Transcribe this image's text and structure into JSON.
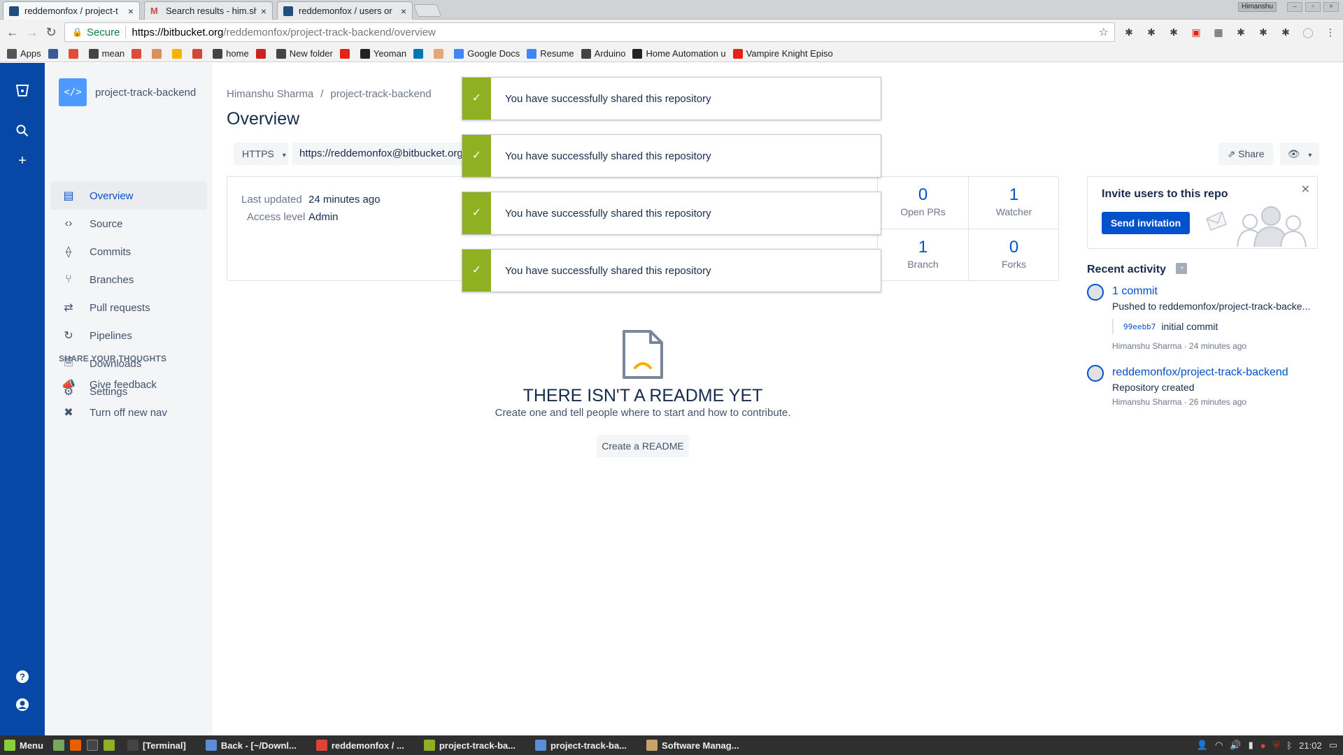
{
  "browser": {
    "tabs": [
      {
        "title": "reddemonfox / project-t",
        "active": true
      },
      {
        "title": "Search results - him.sha",
        "active": false
      },
      {
        "title": "reddemonfox / users or",
        "active": false
      }
    ],
    "window_user": "Himanshu",
    "address": {
      "secure_label": "Secure",
      "url_host": "https://bitbucket.org",
      "url_path": "/reddemonfox/project-track-backend/overview"
    },
    "bookmarks": [
      {
        "label": "Apps",
        "color": "#555555"
      },
      {
        "label": "",
        "color": "#3b5998"
      },
      {
        "label": "",
        "color": "#e04e39"
      },
      {
        "label": "mean",
        "color": "#444444"
      },
      {
        "label": "",
        "color": "#dd4b39"
      },
      {
        "label": "",
        "color": "#d9905a"
      },
      {
        "label": "",
        "color": "#f4b400"
      },
      {
        "label": "",
        "color": "#d44638"
      },
      {
        "label": "home",
        "color": "#444444"
      },
      {
        "label": "",
        "color": "#cc2222"
      },
      {
        "label": "New folder",
        "color": "#444444"
      },
      {
        "label": "",
        "color": "#e62117"
      },
      {
        "label": "Yeoman",
        "color": "#222222"
      },
      {
        "label": "",
        "color": "#0077b5"
      },
      {
        "label": "",
        "color": "#e3a87a"
      },
      {
        "label": "Google Docs",
        "color": "#4285f4"
      },
      {
        "label": "Resume",
        "color": "#4285f4"
      },
      {
        "label": "Arduino",
        "color": "#444444"
      },
      {
        "label": "Home Automation u",
        "color": "#222222"
      },
      {
        "label": "Vampire Knight Episo",
        "color": "#e62117"
      }
    ]
  },
  "sidebar": {
    "repo_name": "project-track-backend",
    "repo_avatar": "</>",
    "items": [
      {
        "label": "Overview",
        "icon": "overview-icon",
        "glyph": "▤",
        "active": true
      },
      {
        "label": "Source",
        "icon": "source-icon",
        "glyph": "‹›",
        "active": false
      },
      {
        "label": "Commits",
        "icon": "commits-icon",
        "glyph": "⟠",
        "active": false
      },
      {
        "label": "Branches",
        "icon": "branches-icon",
        "glyph": "⑂",
        "active": false
      },
      {
        "label": "Pull requests",
        "icon": "pull-requests-icon",
        "glyph": "⇄",
        "active": false
      },
      {
        "label": "Pipelines",
        "icon": "pipelines-icon",
        "glyph": "↻",
        "active": false
      },
      {
        "label": "Downloads",
        "icon": "downloads-icon",
        "glyph": "🗎",
        "active": false
      },
      {
        "label": "Settings",
        "icon": "settings-icon",
        "glyph": "⚙",
        "active": false
      }
    ],
    "section_heading": "SHARE YOUR THOUGHTS",
    "feedback_items": [
      {
        "label": "Give feedback",
        "icon": "megaphone-icon",
        "glyph": "📣"
      },
      {
        "label": "Turn off new nav",
        "icon": "close-circle-icon",
        "glyph": "✖"
      }
    ]
  },
  "main": {
    "breadcrumb": {
      "owner": "Himanshu Sharma",
      "separator": "/",
      "repo": "project-track-backend"
    },
    "title": "Overview",
    "clone": {
      "protocol": "HTTPS",
      "url": "https://reddemonfox@bitbucket.org"
    },
    "share_label": "Share",
    "info": {
      "last_updated_label": "Last updated",
      "last_updated_value": "24 minutes ago",
      "access_label": "Access level",
      "access_value": "Admin"
    },
    "stats": [
      {
        "num": "0",
        "label": "Open PRs"
      },
      {
        "num": "1",
        "label": "Watcher"
      },
      {
        "num": "1",
        "label": "Branch"
      },
      {
        "num": "0",
        "label": "Forks"
      }
    ],
    "toasts": [
      "You have successfully shared this repository",
      "You have successfully shared this repository",
      "You have successfully shared this repository",
      "You have successfully shared this repository"
    ],
    "readme": {
      "title": "THERE ISN'T A README YET",
      "subtitle": "Create one and tell people where to start and how to contribute.",
      "button": "Create a README"
    }
  },
  "right": {
    "invite_title": "Invite users to this repo",
    "invite_button": "Send invitation",
    "recent_title": "Recent activity",
    "activity": [
      {
        "link": "1 commit",
        "text": "Pushed to reddemonfox/project-track-backe...",
        "commit_hash": "99eebb7",
        "commit_msg": "initial commit",
        "meta": "Himanshu Sharma · 24 minutes ago"
      },
      {
        "link": "reddemonfox/project-track-backend",
        "text": "Repository created",
        "meta": "Himanshu Sharma · 26 minutes ago"
      }
    ]
  },
  "taskbar": {
    "menu_label": "Menu",
    "items": [
      {
        "label": "[Terminal]",
        "color": "#444444"
      },
      {
        "label": "Back - [~/Downl...",
        "color": "#5a8dd6"
      },
      {
        "label": "reddemonfox / ...",
        "color": "#db4437"
      },
      {
        "label": "project-track-ba...",
        "color": "#8fb021"
      },
      {
        "label": "project-track-ba...",
        "color": "#5a8dd6"
      },
      {
        "label": "Software Manag...",
        "color": "#c9a26b"
      }
    ],
    "clock": "21:02"
  },
  "colors": {
    "global_nav": "#0747a6",
    "link": "#0052cc",
    "success": "#8fb021"
  }
}
